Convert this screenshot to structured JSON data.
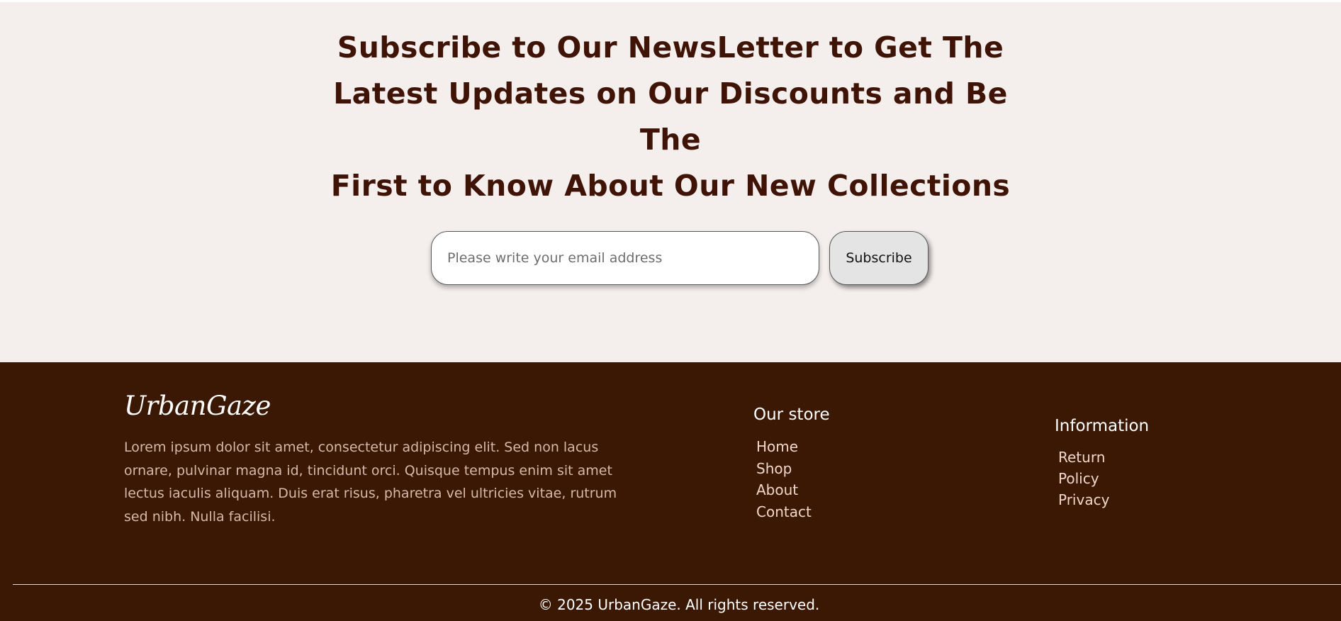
{
  "newsletter": {
    "heading_line1": "Subscribe to Our NewsLetter to Get The",
    "heading_line2": "Latest Updates on Our Discounts and Be The",
    "heading_line3": "First to Know About Our New Collections",
    "email_placeholder": "Please write your email address",
    "email_value": "",
    "subscribe_label": "Subscribe"
  },
  "footer": {
    "brand": "UrbanGaze",
    "about_text": "Lorem ipsum dolor sit amet, consectetur adipiscing elit. Sed non lacus ornare, pulvinar magna id, tincidunt orci. Quisque tempus enim sit amet lectus iaculis aliquam. Duis erat risus, pharetra vel ultricies vitae, rutrum sed nibh. Nulla facilisi.",
    "store": {
      "title": "Our store",
      "links": [
        "Home",
        "Shop",
        "About",
        "Contact"
      ]
    },
    "information": {
      "title": "Information",
      "links": [
        "Return",
        "Policy",
        "Privacy"
      ]
    },
    "copyright": "© 2025 UrbanGaze. All rights reserved."
  },
  "colors": {
    "newsletter_bg": "#f4efed",
    "heading": "#3f1407",
    "footer_bg": "#3b1803",
    "footer_text": "#d7b8a9",
    "button_bg": "#e4e4e4"
  }
}
